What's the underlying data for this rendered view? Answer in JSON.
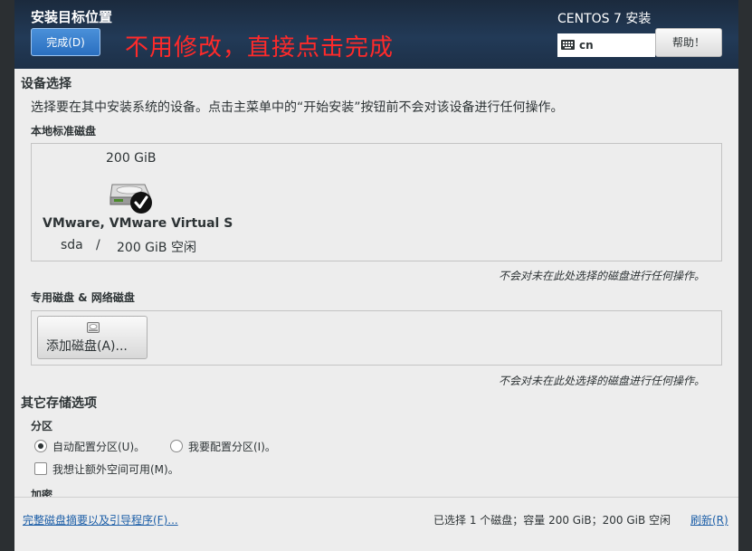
{
  "header": {
    "title": "安装目标位置",
    "done_label": "完成(D)",
    "annotation": "不用修改，直接点击完成",
    "product": "CENTOS 7 安装",
    "keyboard_layout": "cn",
    "help_label": "帮助！"
  },
  "device_selection": {
    "title": "设备选择",
    "description": "选择要在其中安装系统的设备。点击主菜单中的“开始安装”按钮前不会对该设备进行任何操作。",
    "local_disks": {
      "title": "本地标准磁盘",
      "disks": [
        {
          "size": "200 GiB",
          "name": "VMware, VMware Virtual S",
          "device": "sda",
          "separator": "/",
          "free": "200 GiB 空闲",
          "selected": true
        }
      ],
      "note": "不会对未在此处选择的磁盘进行任何操作。"
    },
    "special_disks": {
      "title": "专用磁盘 & 网络磁盘",
      "add_label": "添加磁盘(A)...",
      "note": "不会对未在此处选择的磁盘进行任何操作。"
    }
  },
  "other_options": {
    "title": "其它存储选项",
    "partitioning": {
      "title": "分区",
      "auto_label": "自动配置分区(U)。",
      "manual_label": "我要配置分区(I)。",
      "extra_space_label": "我想让额外空间可用(M)。",
      "selected": "auto",
      "extra_space_checked": false
    },
    "encryption_title": "加密"
  },
  "footer": {
    "summary_link": "完整磁盘摘要以及引导程序(F)...",
    "status": "已选择 1 个磁盘；容量 200 GiB；200 GiB 空闲",
    "refresh_link": "刷新(R)"
  }
}
